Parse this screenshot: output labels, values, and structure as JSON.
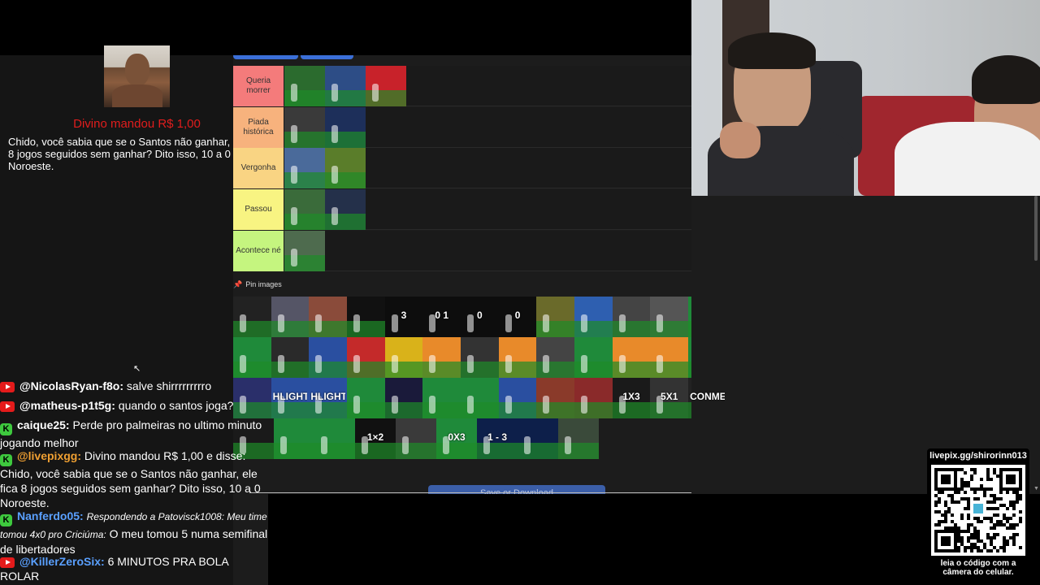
{
  "donation": {
    "title": "Divino mandou R$ 1,00",
    "message": "Chido, você sabia que se o Santos não ganhar, ele fica 8 jogos seguidos sem ganhar? Dito isso, 10 a 0 Noroeste."
  },
  "tiers": [
    {
      "label": "Queria morrer",
      "color": "#f47b7b",
      "items": [
        "#2b6b2e",
        "#2d4d86",
        "#c8222a"
      ]
    },
    {
      "label": "Piada histórica",
      "color": "#f7b27d",
      "items": [
        "#3a3a3a",
        "#1d2f5a"
      ]
    },
    {
      "label": "Vergonha",
      "color": "#f9d483",
      "items": [
        "#4a6a9a",
        "#5a7d2a"
      ]
    },
    {
      "label": "Passou",
      "color": "#f8f482",
      "items": [
        "#3a6b3a",
        "#24304a"
      ]
    },
    {
      "label": "Acontece né",
      "color": "#c5f57f",
      "items": [
        "#4e6b4e"
      ]
    }
  ],
  "pin_label": "Pin images",
  "pool": [
    [
      {
        "c": "#222"
      },
      {
        "c": "#556"
      },
      {
        "c": "#8a4b3a"
      },
      {
        "c": "#111"
      },
      {
        "c": "#0d0d0d",
        "t": "3"
      },
      {
        "c": "#0d0d0d",
        "t": "0 1"
      },
      {
        "c": "#0d0d0d",
        "t": "0"
      },
      {
        "c": "#0d0d0d",
        "t": "0"
      },
      {
        "c": "#6a6a2a"
      },
      {
        "c": "#2e5fb0"
      },
      {
        "c": "#444"
      },
      {
        "c": "#555"
      },
      {
        "c": "#1f8a3a"
      },
      {
        "c": "#1f8a3a"
      },
      {
        "c": "#2f7a2f"
      }
    ],
    [
      {
        "c": "#1f8a3a"
      },
      {
        "c": "#2a2a2a"
      },
      {
        "c": "#2a4fa0"
      },
      {
        "c": "#c42a2a"
      },
      {
        "c": "#d9b21a"
      },
      {
        "c": "#e88a2a"
      },
      {
        "c": "#333"
      },
      {
        "c": "#e88a2a"
      },
      {
        "c": "#444"
      },
      {
        "c": "#1f8a3a"
      },
      {
        "c": "#e88a2a"
      },
      {
        "c": "#e88a2a"
      },
      {
        "c": "#1f8a3a"
      },
      {
        "c": "#2a4fa0"
      },
      {
        "c": "#1f4fa0"
      }
    ],
    [
      {
        "c": "#2a2f6a"
      },
      {
        "c": "#2a4fa0",
        "t": "HLIGHTS"
      },
      {
        "c": "#2a4fa0",
        "t": "HLIGHTS"
      },
      {
        "c": "#1f8a3a"
      },
      {
        "c": "#1a1a3a"
      },
      {
        "c": "#1f8a3a"
      },
      {
        "c": "#1f8a3a"
      },
      {
        "c": "#2a4fa0"
      },
      {
        "c": "#8a3a2a"
      },
      {
        "c": "#8a2a2a"
      },
      {
        "c": "#1a1a1a",
        "t": "1X3"
      },
      {
        "c": "#333",
        "t": "5X1"
      },
      {
        "c": "#222",
        "t": "CONME"
      },
      {
        "c": "#1f8a3a"
      },
      {
        "c": "#1f8a3a"
      }
    ],
    [
      {
        "c": "#1a1a1a"
      },
      {
        "c": "#1f8a3a"
      },
      {
        "c": "#1f8a3a"
      },
      {
        "c": "#111",
        "t": "1×2"
      },
      {
        "c": "#3a3a3a"
      },
      {
        "c": "#1f8a3a",
        "t": "0X3"
      },
      {
        "c": "#0d1f4a",
        "t": "1 - 3"
      },
      {
        "c": "#0d1f4a"
      },
      {
        "c": "#3a4a3a"
      }
    ]
  ],
  "save_button": "Save or Download",
  "chat": [
    {
      "platform": "yt",
      "user": "@NicolasRyan-f8o:",
      "user_color": "#ffffff",
      "text": "salve shirrrrrrrrro"
    },
    {
      "platform": "yt",
      "user": "@matheus-p1t5g:",
      "user_color": "#ffffff",
      "text": "quando o santos joga?"
    },
    {
      "platform": "kick",
      "user": "caique25:",
      "user_color": "#ffffff",
      "text": "Perde pro palmeiras no ultimo minuto jogando melhor"
    },
    {
      "platform": "kick",
      "user": "@livepixgg:",
      "user_color": "#f0a032",
      "text": "Divino mandou R$ 1,00 e disse: Chido, você sabia que se o Santos não ganhar, ele fica 8 jogos seguidos sem ganhar? Dito isso, 10 a 0 Noroeste."
    },
    {
      "platform": "kick",
      "user": "Nanferdo05:",
      "user_color": "#5aa0ff",
      "reply": "Respondendo a Patovisck1008: Meu time tomou 4x0 pro Criciúma:",
      "text": "O meu tomou 5 numa semifinal de libertadores"
    },
    {
      "platform": "yt",
      "user": "@KillerZeroSix:",
      "user_color": "#5aa0ff",
      "text": "6 MINUTOS PRA BOLA ROLAR"
    }
  ],
  "qr": {
    "url": "livepix.gg/shirorinn013",
    "caption": "leia o código com a câmera do celular."
  }
}
